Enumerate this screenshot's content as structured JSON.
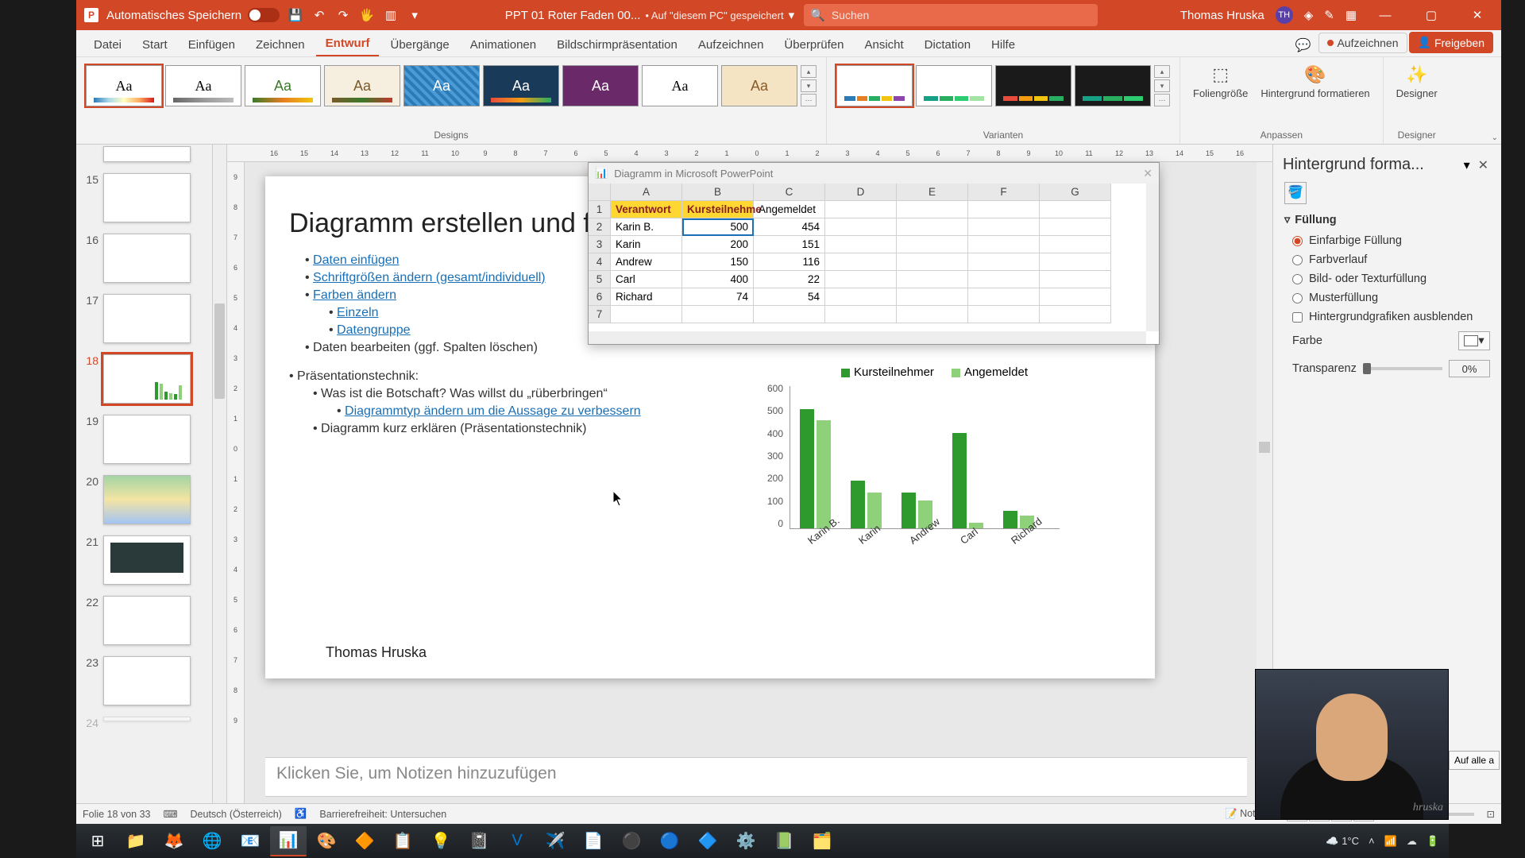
{
  "titlebar": {
    "autosave_label": "Automatisches Speichern",
    "doc_title": "PPT 01 Roter Faden 00...",
    "saved_location": "• Auf \"diesem PC\" gespeichert",
    "search_placeholder": "Suchen",
    "user_name": "Thomas Hruska",
    "user_initials": "TH"
  },
  "ribbon_tabs": [
    "Datei",
    "Start",
    "Einfügen",
    "Zeichnen",
    "Entwurf",
    "Übergänge",
    "Animationen",
    "Bildschirmpräsentation",
    "Aufzeichnen",
    "Überprüfen",
    "Ansicht",
    "Dictation",
    "Hilfe"
  ],
  "ribbon_active": "Entwurf",
  "record_btn": "Aufzeichnen",
  "share_btn": "Freigeben",
  "group_designs": "Designs",
  "group_variants": "Varianten",
  "group_adjust": "Anpassen",
  "group_designer": "Designer",
  "btn_slidesize": "Foliengröße",
  "btn_formatbg": "Hintergrund formatieren",
  "btn_designer": "Designer",
  "ruler_h": [
    "16",
    "15",
    "14",
    "13",
    "12",
    "11",
    "10",
    "9",
    "8",
    "7",
    "6",
    "5",
    "4",
    "3",
    "2",
    "1",
    "0",
    "1",
    "2",
    "3",
    "4",
    "5",
    "6",
    "7",
    "8",
    "9",
    "10",
    "11",
    "12",
    "13",
    "14",
    "15",
    "16"
  ],
  "ruler_v": [
    "9",
    "8",
    "7",
    "6",
    "5",
    "4",
    "3",
    "2",
    "1",
    "0",
    "1",
    "2",
    "3",
    "4",
    "5",
    "6",
    "7",
    "8",
    "9"
  ],
  "thumbs": [
    {
      "n": "15"
    },
    {
      "n": "16"
    },
    {
      "n": "17"
    },
    {
      "n": "18"
    },
    {
      "n": "19"
    },
    {
      "n": "20"
    },
    {
      "n": "21"
    },
    {
      "n": "22"
    },
    {
      "n": "23"
    },
    {
      "n": "24"
    }
  ],
  "slide": {
    "title": "Diagramm erstellen und formatieren",
    "bullets": {
      "b1": "Daten einfügen",
      "b2": "Schriftgrößen ändern (gesamt/individuell)",
      "b3": "Farben ändern",
      "b3a": "Einzeln",
      "b3b": "Datengruppe",
      "b4": "Daten bearbeiten (ggf. Spalten löschen)",
      "b5": "Präsentationstechnik:",
      "b5a": "Was ist die Botschaft? Was willst du „rüberbringen“",
      "b5a1": "Diagrammtyp ändern um die Aussage zu verbessern",
      "b5b": "Diagramm kurz erklären (Präsentationstechnik)"
    },
    "footer": "Thomas Hruska"
  },
  "chart_window": {
    "title": "Diagramm in Microsoft PowerPoint",
    "cols": [
      "A",
      "B",
      "C",
      "D",
      "E",
      "F",
      "G"
    ],
    "header_row": [
      "Verantwort",
      "Kursteilnehme",
      "Angemeldet",
      "",
      "",
      "",
      ""
    ],
    "rows": [
      [
        "Karin B.",
        "500",
        "454",
        "",
        "",
        "",
        ""
      ],
      [
        "Karin",
        "200",
        "151",
        "",
        "",
        "",
        ""
      ],
      [
        "Andrew",
        "150",
        "116",
        "",
        "",
        "",
        ""
      ],
      [
        "Carl",
        "400",
        "22",
        "",
        "",
        "",
        ""
      ],
      [
        "Richard",
        "74",
        "54",
        "",
        "",
        "",
        ""
      ]
    ]
  },
  "chart_data": {
    "type": "bar",
    "title": "",
    "xlabel": "",
    "ylabel": "",
    "ylim": [
      0,
      600
    ],
    "yticks": [
      0,
      100,
      200,
      300,
      400,
      500,
      600
    ],
    "categories": [
      "Karin B.",
      "Karin",
      "Andrew",
      "Carl",
      "Richard"
    ],
    "series": [
      {
        "name": "Kursteilnehmer",
        "values": [
          500,
          200,
          150,
          400,
          74
        ],
        "color": "#2e9a2e"
      },
      {
        "name": "Angemeldet",
        "values": [
          454,
          151,
          116,
          22,
          54
        ],
        "color": "#8fd17a"
      }
    ]
  },
  "notes_placeholder": "Klicken Sie, um Notizen hinzuzufügen",
  "format_pane": {
    "title": "Hintergrund forma...",
    "section": "Füllung",
    "opt1": "Einfarbige Füllung",
    "opt2": "Farbverlauf",
    "opt3": "Bild- oder Texturfüllung",
    "opt4": "Musterfüllung",
    "opt5": "Hintergrundgrafiken ausblenden",
    "color_label": "Farbe",
    "trans_label": "Transparenz",
    "trans_value": "0%",
    "apply_all": "Auf alle a"
  },
  "status": {
    "slide_of": "Folie 18 von 33",
    "lang": "Deutsch (Österreich)",
    "access": "Barrierefreiheit: Untersuchen",
    "notes": "Notizen"
  },
  "tray": {
    "weather": "1°C"
  }
}
